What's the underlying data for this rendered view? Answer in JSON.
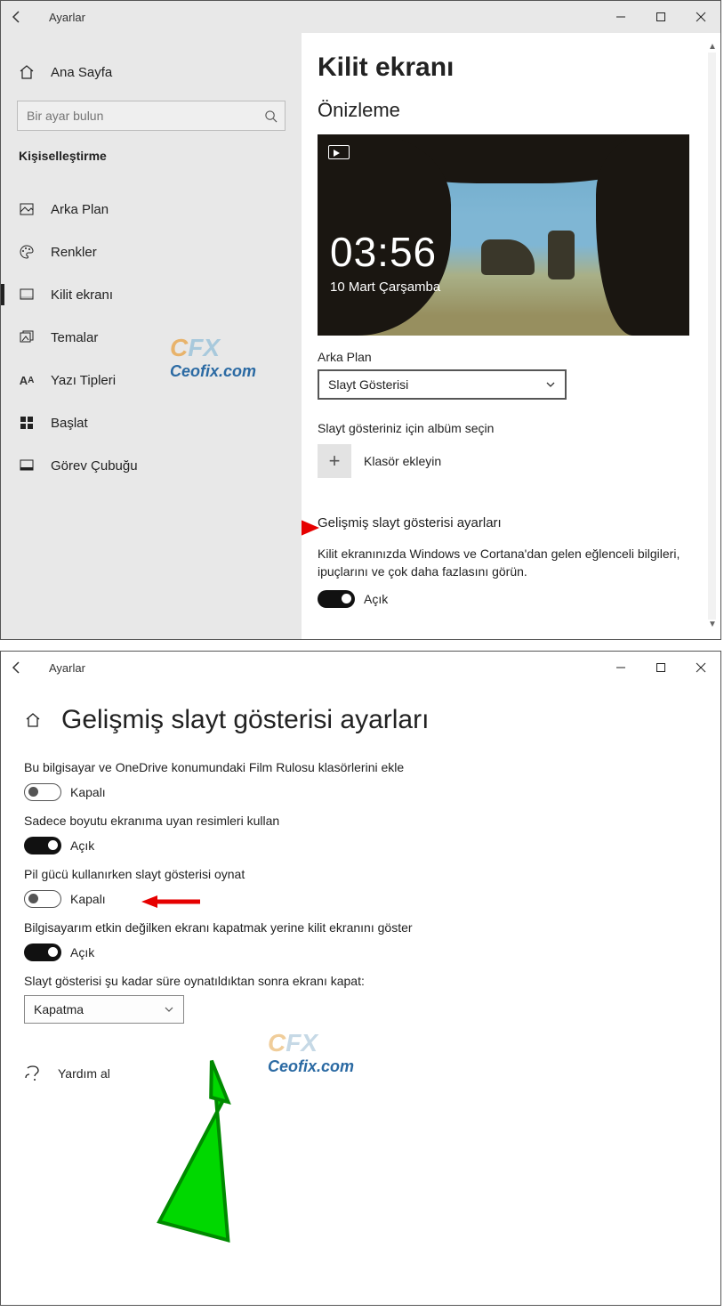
{
  "win1": {
    "titlebar_title": "Ayarlar",
    "sidebar": {
      "home_label": "Ana Sayfa",
      "search_placeholder": "Bir ayar bulun",
      "section_label": "Kişiselleştirme",
      "items": [
        {
          "label": "Arka Plan"
        },
        {
          "label": "Renkler"
        },
        {
          "label": "Kilit ekranı"
        },
        {
          "label": "Temalar"
        },
        {
          "label": "Yazı Tipleri"
        },
        {
          "label": "Başlat"
        },
        {
          "label": "Görev Çubuğu"
        }
      ]
    },
    "page_title": "Kilit ekranı",
    "preview_heading": "Önizleme",
    "preview_time": "03:56",
    "preview_date": "10 Mart Çarşamba",
    "bg_label": "Arka Plan",
    "bg_value": "Slayt Gösterisi",
    "album_label": "Slayt gösteriniz için albüm seçin",
    "add_folder_label": "Klasör ekleyin",
    "advanced_link": "Gelişmiş slayt gösterisi ayarları",
    "tips_desc": "Kilit ekranınızda Windows ve Cortana'dan gelen eğlenceli bilgileri, ipuçlarını ve çok daha fazlasını görün.",
    "tips_toggle_label": "Açık",
    "watermark_line1": "CFX",
    "watermark_line2": "Ceofix.com"
  },
  "win2": {
    "titlebar_title": "Ayarlar",
    "page_title": "Gelişmiş slayt gösterisi ayarları",
    "settings": [
      {
        "label": "Bu bilgisayar ve OneDrive konumundaki Film Rulosu klasörlerini ekle",
        "state": "off",
        "state_label": "Kapalı"
      },
      {
        "label": "Sadece boyutu ekranıma uyan resimleri kullan",
        "state": "on",
        "state_label": "Açık"
      },
      {
        "label": "Pil gücü kullanırken slayt gösterisi oynat",
        "state": "off",
        "state_label": "Kapalı"
      },
      {
        "label": "Bilgisayarım etkin değilken ekranı kapatmak yerine kilit ekranını göster",
        "state": "on",
        "state_label": "Açık"
      }
    ],
    "timeout_label": "Slayt gösterisi şu kadar süre oynatıldıktan sonra ekranı kapat:",
    "timeout_value": "Kapatma",
    "help_label": "Yardım al",
    "watermark_line1": "CFX",
    "watermark_line2": "Ceofix.com"
  }
}
